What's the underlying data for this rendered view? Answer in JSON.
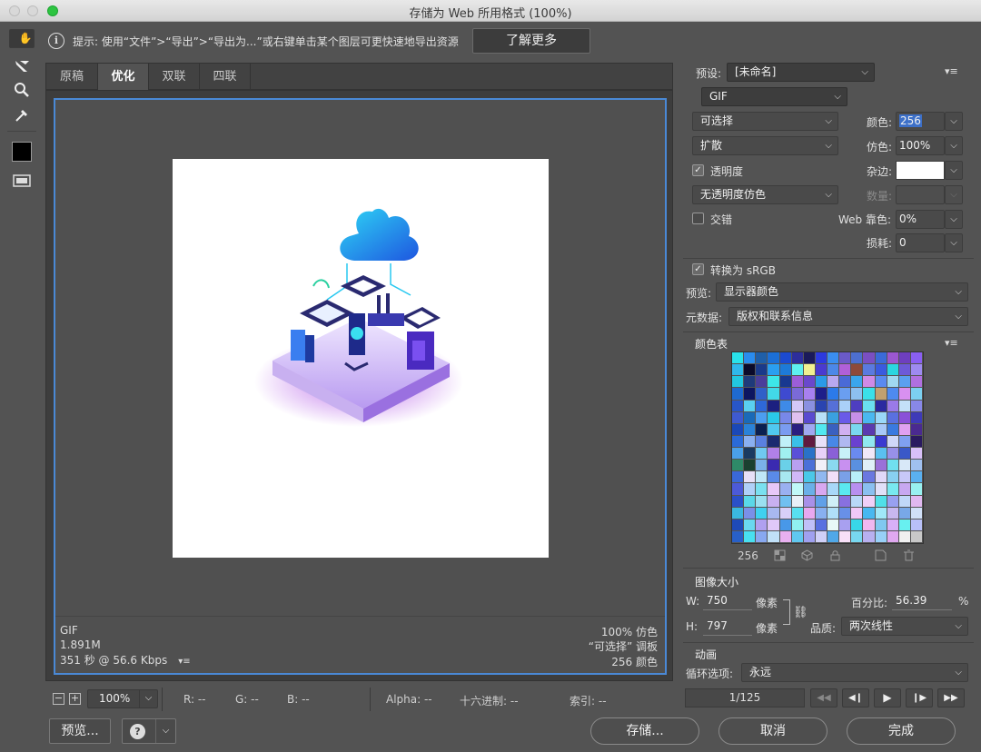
{
  "window": {
    "title": "存储为 Web 所用格式 (100%)"
  },
  "hint": {
    "text": "提示: 使用“文件”>“导出”>“导出为...”或右键单击某个图层可更快速地导出资源",
    "learn_more": "了解更多"
  },
  "tabs": [
    {
      "label": "原稿"
    },
    {
      "label": "优化"
    },
    {
      "label": "双联"
    },
    {
      "label": "四联"
    }
  ],
  "status": {
    "format": "GIF",
    "size": "1.891M",
    "time": "351 秒 @ 56.6 Kbps",
    "time_menu": "▾≡",
    "dither": "100% 仿色",
    "palette": "“可选择” 调板",
    "colors": "256 颜色"
  },
  "infobar": {
    "zoom": "100%",
    "r": "R: --",
    "g": "G: --",
    "b": "B: --",
    "alpha": "Alpha: --",
    "hex": "十六进制: --",
    "index": "索引: --"
  },
  "buttons": {
    "preview": "预览...",
    "save": "存储...",
    "cancel": "取消",
    "done": "完成"
  },
  "settings": {
    "preset_label": "预设:",
    "preset_value": "[未命名]",
    "format": "GIF",
    "reduction": "可选择",
    "colors_label": "颜色:",
    "colors_value": "256",
    "dither_algo": "扩散",
    "dither_label": "仿色:",
    "dither_value": "100%",
    "transparency_label": "透明度",
    "matte_label": "杂边:",
    "trans_dither": "无透明度仿色",
    "amount_label": "数量:",
    "interlaced_label": "交错",
    "websnap_label": "Web 靠色:",
    "websnap_value": "0%",
    "lossy_label": "损耗:",
    "lossy_value": "0",
    "srgb_label": "转换为 sRGB",
    "preview_label": "预览:",
    "preview_value": "显示器颜色",
    "metadata_label": "元数据:",
    "metadata_value": "版权和联系信息"
  },
  "color_table": {
    "title": "颜色表",
    "count": "256",
    "colors": [
      "#29e3ea",
      "#2a8cee",
      "#1f5fa8",
      "#1b6fd6",
      "#1c4ad0",
      "#2d2e9c",
      "#1a1a5a",
      "#2c3adf",
      "#3a8ef0",
      "#6a5ac8",
      "#4d6fd0",
      "#7a4fc2",
      "#3b6ad8",
      "#9b57d0",
      "#6e3fbf",
      "#8a5ff2",
      "#2fb8ea",
      "#0a0a2a",
      "#1a3a8a",
      "#2a9ff0",
      "#1d7ad8",
      "#5ef0f0",
      "#f0f090",
      "#4a3ad0",
      "#4c88e8",
      "#b060d8",
      "#8d4a3a",
      "#5a7ae0",
      "#3a5adf",
      "#2ad6e0",
      "#6d5ad8",
      "#9e8af0",
      "#22c7e0",
      "#1e3a7a",
      "#4a3e9a",
      "#3de6e8",
      "#183890",
      "#9c5ed8",
      "#6a48cc",
      "#2a9ae8",
      "#b8a8f0",
      "#4a6ad6",
      "#3aa6ec",
      "#cf8ae6",
      "#5a8af0",
      "#a0d8f0",
      "#5aa0f0",
      "#b070e0",
      "#1e6ad0",
      "#0d1560",
      "#3060c8",
      "#42d8e8",
      "#3e4ad0",
      "#7a6ad8",
      "#a880f0",
      "#1e1e8a",
      "#2c7aea",
      "#6a9ef0",
      "#8dc0f0",
      "#3ae0e8",
      "#c0a070",
      "#4e8af0",
      "#d890f0",
      "#7cd0f0",
      "#2856c8",
      "#5ad0f0",
      "#2e68d8",
      "#1c2080",
      "#3e8ae8",
      "#d4c8f8",
      "#8a90e0",
      "#2a44b0",
      "#5670d8",
      "#aad0f8",
      "#4e3ec0",
      "#6ae0f0",
      "#2a2aa0",
      "#9a7ae8",
      "#c4e0f8",
      "#8888e8",
      "#3e5ad0",
      "#1a6ab8",
      "#4c9ef0",
      "#2ac8e8",
      "#7888e8",
      "#e0c0f0",
      "#5a4ad0",
      "#b8e0f8",
      "#3aa0e0",
      "#6a5ae8",
      "#c690e8",
      "#4ab8f0",
      "#9ad8f8",
      "#5a70e0",
      "#8a50d8",
      "#3e3ab8",
      "#1a48b8",
      "#2a82d8",
      "#0a2050",
      "#50c8f0",
      "#7a9cf0",
      "#2a1e80",
      "#a0a8f0",
      "#52e8f0",
      "#3a60c0",
      "#d0b0f0",
      "#7ad8f0",
      "#5a3ab0",
      "#a8c8f8",
      "#3a7ae0",
      "#e0a0f0",
      "#4a2a90",
      "#2a6ad8",
      "#8ab0f0",
      "#5a80e0",
      "#1a2a70",
      "#c0f0f8",
      "#3ac0e8",
      "#601a40",
      "#e8e0f8",
      "#4888e8",
      "#b0b8f0",
      "#6a40d0",
      "#90e8f0",
      "#3a3ad0",
      "#d0d8f8",
      "#80a0f0",
      "#2a1a60",
      "#4aa0e8",
      "#1a3a60",
      "#70c8f0",
      "#b080e8",
      "#a0f0f0",
      "#5a50d8",
      "#2a72c8",
      "#e8d0f8",
      "#8a60d8",
      "#c8f0f8",
      "#6a8af0",
      "#f0e8f8",
      "#5ac0f0",
      "#9890e8",
      "#3a58c8",
      "#d8c0f8",
      "#2e8a68",
      "#1a4030",
      "#7ab0e8",
      "#3a2ab0",
      "#6ad0e8",
      "#b8a0f0",
      "#4a70d8",
      "#f0f0f8",
      "#8ad8f0",
      "#c890f0",
      "#5a90e0",
      "#e0f0f8",
      "#9a70d8",
      "#70e0f0",
      "#d8e8f8",
      "#a0c0f0",
      "#3a68d8",
      "#e8e0f8",
      "#c0e8f8",
      "#5a8ae8",
      "#a8e8f0",
      "#d0b8f8",
      "#4ac8e8",
      "#90b8f0",
      "#f0e0f8",
      "#7aa0e8",
      "#b8f0f8",
      "#6a78e0",
      "#e0d8f8",
      "#88d0f0",
      "#c8c8f8",
      "#5ab0f0",
      "#4c5ad8",
      "#b0d0f8",
      "#7ae0f0",
      "#e8c8f8",
      "#9ab0f0",
      "#c0f8f8",
      "#6ab0e8",
      "#d8a8f0",
      "#a8d8f8",
      "#5ae8f0",
      "#b890f0",
      "#8ac0f0",
      "#e0e0f8",
      "#78e8f0",
      "#c8a8f0",
      "#98f0f0",
      "#2a50c8",
      "#5ad8e8",
      "#9ae0f0",
      "#c8b0f0",
      "#70c0f0",
      "#e8f0f8",
      "#a890e8",
      "#60a0e8",
      "#d0f0f8",
      "#8870e0",
      "#b8d8f8",
      "#f0d0f8",
      "#50e0e8",
      "#98a0f0",
      "#c0d8f8",
      "#e0b8f0",
      "#3ab8e0",
      "#7a90e8",
      "#40d0f0",
      "#a8b8f0",
      "#d8d0f8",
      "#58e0f0",
      "#e8a8f0",
      "#88b0f0",
      "#b0e0f8",
      "#6890e8",
      "#f0c8f8",
      "#48b8f0",
      "#a0e8f8",
      "#c8b8f0",
      "#78a8e8",
      "#d0e0f8",
      "#1e4ab8",
      "#6ad8f0",
      "#b0a0f0",
      "#e0c8f8",
      "#4898e8",
      "#90f0f0",
      "#c0c0f8",
      "#5870e0",
      "#e8f8f8",
      "#a8a0f0",
      "#38d8e8",
      "#f0b8f0",
      "#80c8f0",
      "#d8b0f8",
      "#68f0f0",
      "#b8c0f8",
      "#2860c8",
      "#48e0f0",
      "#88a8f0",
      "#c0e0f8",
      "#e8b0f0",
      "#60c8f0",
      "#a0a0f0",
      "#d0d0f8",
      "#50a8e8",
      "#f8e0f8",
      "#78d8f0",
      "#b8b0f0",
      "#98d0f8",
      "#e0a8f0",
      "#f0f0f0",
      "#c8c8c8"
    ]
  },
  "image_size": {
    "title": "图像大小",
    "w_label": "W:",
    "w_value": "750",
    "h_label": "H:",
    "h_value": "797",
    "unit": "像素",
    "percent_label": "百分比:",
    "percent_value": "56.39",
    "percent_unit": "%",
    "quality_label": "品质:",
    "quality_value": "两次线性"
  },
  "animation": {
    "title": "动画",
    "loop_label": "循环选项:",
    "loop_value": "永远",
    "frame": "1/125"
  }
}
